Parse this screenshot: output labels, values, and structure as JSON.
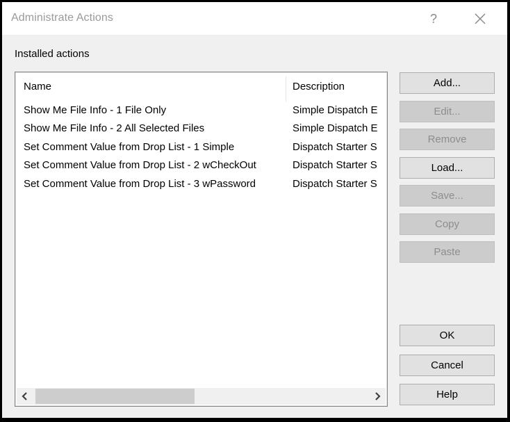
{
  "window": {
    "title": "Administrate Actions",
    "help_label": "?",
    "close_icon": "close-icon"
  },
  "section_label": "Installed actions",
  "list": {
    "columns": [
      "Name",
      "Description"
    ],
    "rows": [
      {
        "name": "Show Me File Info - 1 File Only",
        "description": "Simple Dispatch E"
      },
      {
        "name": "Show Me File Info - 2 All Selected Files",
        "description": "Simple Dispatch E"
      },
      {
        "name": "Set Comment Value from Drop List - 1 Simple",
        "description": "Dispatch Starter S"
      },
      {
        "name": "Set Comment Value from Drop List - 2 wCheckOut",
        "description": "Dispatch Starter S"
      },
      {
        "name": "Set Comment Value from Drop List - 3 wPassword",
        "description": "Dispatch Starter S"
      }
    ],
    "scrollbar": {
      "left_arrow": "chevron-left-icon",
      "right_arrow": "chevron-right-icon",
      "visible_fraction": 0.48,
      "position": 0.0
    }
  },
  "buttons": {
    "add": {
      "label": "Add...",
      "enabled": true
    },
    "edit": {
      "label": "Edit...",
      "enabled": false
    },
    "remove": {
      "label": "Remove",
      "enabled": false
    },
    "load": {
      "label": "Load...",
      "enabled": true
    },
    "save": {
      "label": "Save...",
      "enabled": false
    },
    "copy": {
      "label": "Copy",
      "enabled": false
    },
    "paste": {
      "label": "Paste",
      "enabled": false
    },
    "ok": {
      "label": "OK",
      "enabled": true
    },
    "cancel": {
      "label": "Cancel",
      "enabled": true
    },
    "help": {
      "label": "Help",
      "enabled": true
    }
  }
}
